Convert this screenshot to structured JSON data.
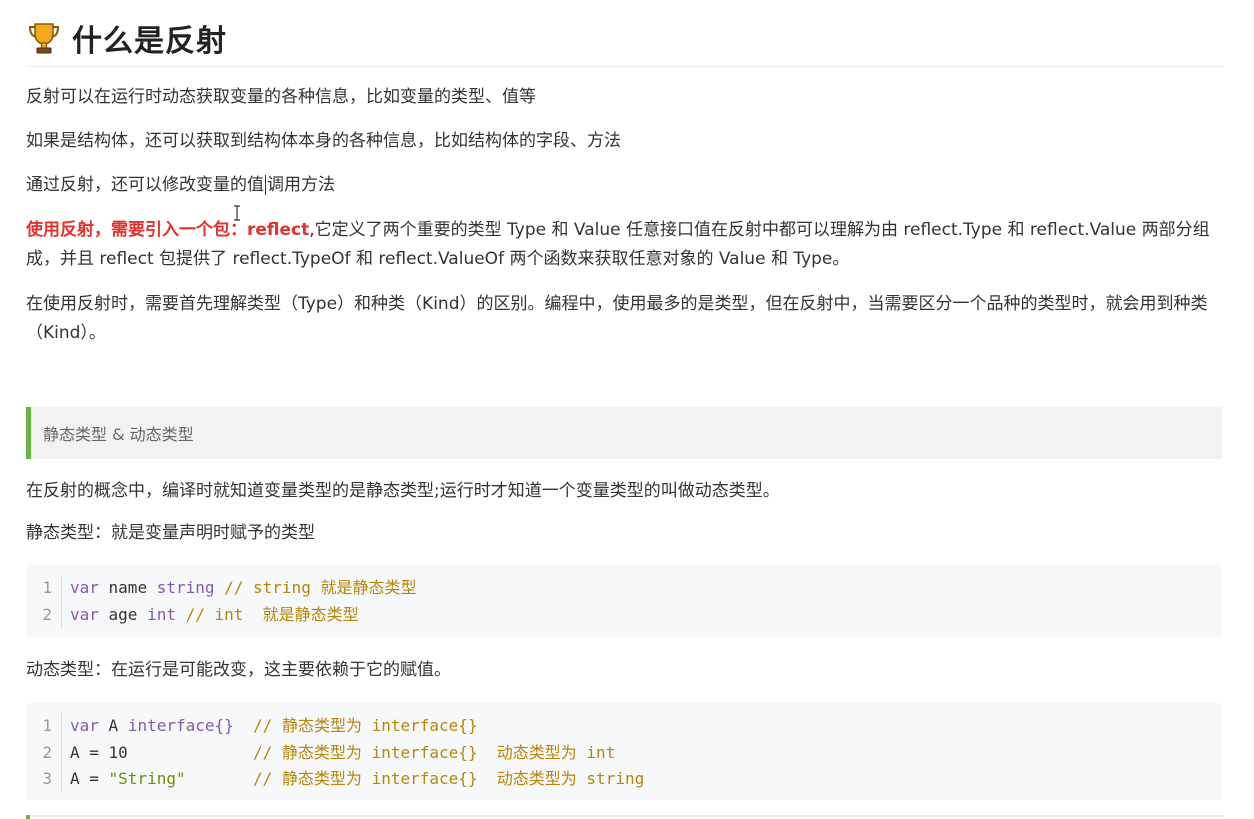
{
  "header": {
    "icon": "trophy-icon",
    "title": "什么是反射"
  },
  "paragraphs": {
    "p1": "反射可以在运行时动态获取变量的各种信息，比如变量的类型、值等",
    "p2": "如果是结构体，还可以获取到结构体本身的各种信息，比如结构体的字段、方法",
    "p3_before": "通过反射，还可以修改变量的值",
    "p3_after": "调用方法",
    "p4_red": "使用反射，需要引入一个包：reflect",
    "p4_rest": ",它定义了两个重要的类型 Type 和 Value 任意接口值在反射中都可以理解为由 reflect.Type 和 reflect.Value 两部分组成，并且 reflect 包提供了 reflect.TypeOf 和 reflect.ValueOf 两个函数来获取任意对象的 Value 和 Type。",
    "p5": "在使用反射时，需要首先理解类型（Type）和种类（Kind）的区别。编程中，使用最多的是类型，但在反射中，当需要区分一个品种的类型时，就会用到种类（Kind）。"
  },
  "section": {
    "heading": "静态类型 & 动态类型",
    "p6": "在反射的概念中，编译时就知道变量类型的是静态类型;运行时才知道一个变量类型的叫做动态类型。",
    "p7": "静态类型：就是变量声明时赋予的类型",
    "p8": "动态类型：在运行是可能改变，这主要依赖于它的赋值。"
  },
  "code_block_1": {
    "lines": [
      {
        "num": "1",
        "kw": "var",
        "name": " name ",
        "type": "string",
        "comment": " // string 就是静态类型"
      },
      {
        "num": "2",
        "kw": "var",
        "name": " age ",
        "type": "int",
        "comment": " // int  就是静态类型"
      }
    ]
  },
  "code_block_2": {
    "lines": [
      {
        "num": "1",
        "pre": "var",
        "mid": " A ",
        "type": "interface{}",
        "pad": "  ",
        "comment": "// 静态类型为 interface{}"
      },
      {
        "num": "2",
        "pre": "",
        "mid": "A = ",
        "type": "10",
        "pad": "             ",
        "comment": "// 静态类型为 interface{}  动态类型为 int"
      },
      {
        "num": "3",
        "pre": "",
        "mid": "A = ",
        "type": "\"String\"",
        "pad": "       ",
        "comment": "// 静态类型为 interface{}  动态类型为 string"
      }
    ]
  },
  "colors": {
    "accent_red": "#e4312b",
    "blockquote_border": "#63b63e",
    "code_background": "#f6f8fa"
  }
}
